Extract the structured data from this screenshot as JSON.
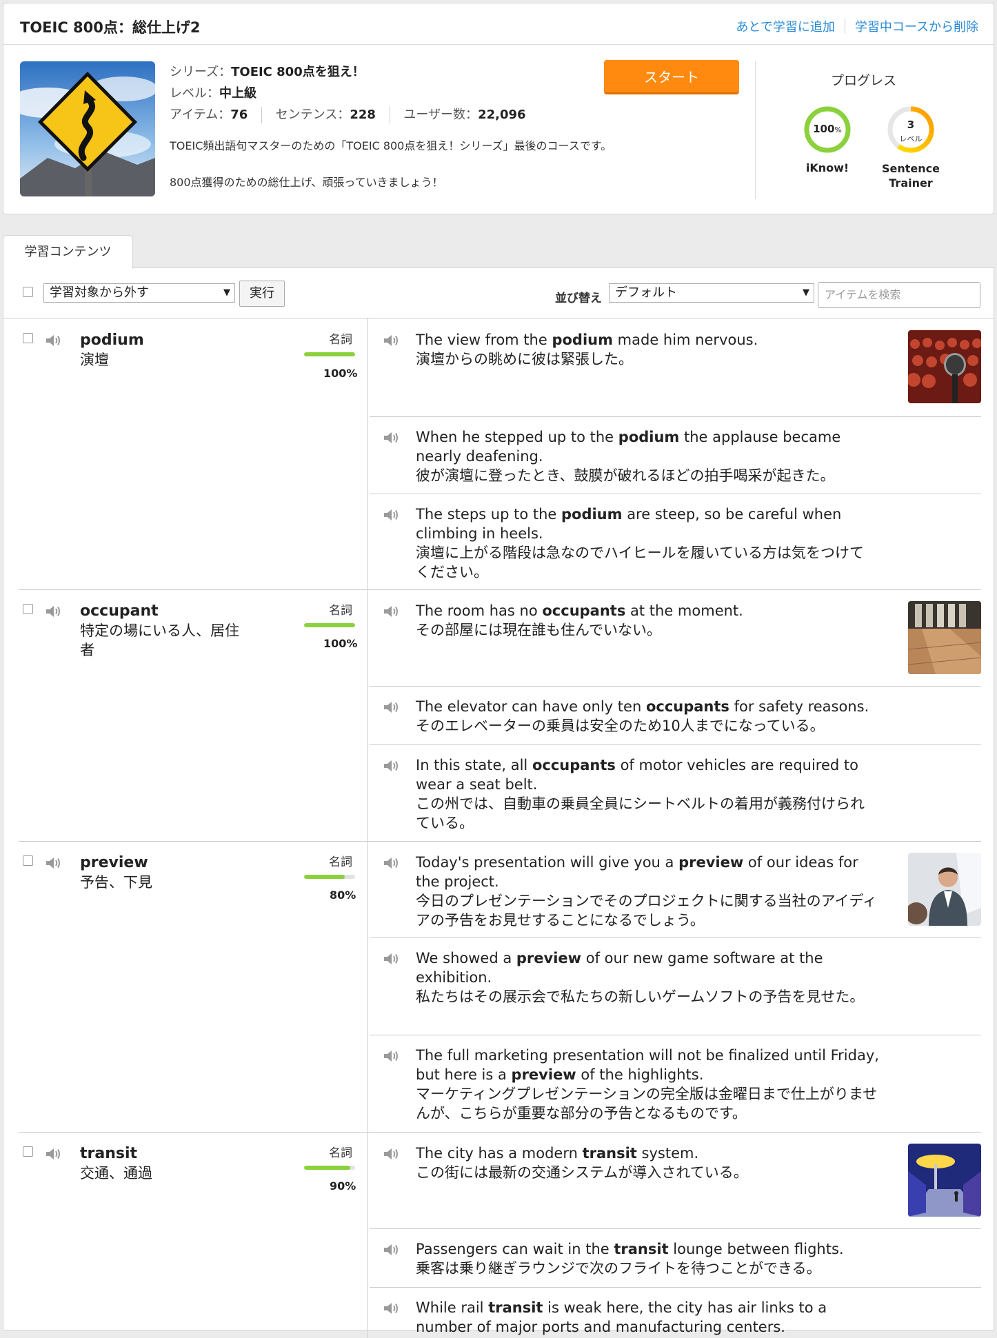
{
  "course": {
    "title": "TOEIC 800点：総仕上げ2",
    "link_add_later": "あとで学習に追加",
    "link_remove": "学習中コースから削除",
    "series_label": "シリーズ：",
    "series_value": "TOEIC 800点を狙え！",
    "level_label": "レベル：",
    "level_value": "中上級",
    "items_label": "アイテム：",
    "items_value": "76",
    "sentences_label": "センテンス：",
    "sentences_value": "228",
    "users_label": "ユーザー数：",
    "users_value": "22,096",
    "description_1": "TOEIC頻出語句マスターのための「TOEIC 800点を狙え！シリーズ」最後のコースです。",
    "description_2": "800点獲得のための総仕上げ、頑張っていきましょう！",
    "start_label": "スタート"
  },
  "progress": {
    "title": "プログレス",
    "iknow_value": "100",
    "iknow_unit": "%",
    "iknow_label": "iKnow!",
    "iknow_fraction": 1.0,
    "trainer_value": "3",
    "trainer_unit": "レベル",
    "trainer_label_1": "Sentence",
    "trainer_label_2": "Trainer",
    "trainer_fraction": 0.6,
    "colors": {
      "iknow": "#8bd13c",
      "trainer_start": "#ffd800",
      "trainer_end": "#ff9a00"
    }
  },
  "tab": {
    "label": "学習コンテンツ"
  },
  "toolbar": {
    "action_select": "学習対象から外す",
    "exec_label": "実行",
    "sort_label": "並び替え",
    "sort_select": "デフォルト",
    "search_placeholder": "アイテムを検索"
  },
  "items": [
    {
      "word": "podium",
      "meaning_1": "演壇",
      "meaning_2": "",
      "pos": "名詞",
      "progress": 1.0,
      "pct": "100%",
      "sentences": [
        {
          "pre": "The view from the ",
          "key": "podium",
          "post": " made him nervous.",
          "ja": "演壇からの眺めに彼は緊張した。"
        },
        {
          "pre": "When he stepped up to the ",
          "key": "podium",
          "post": " the applause became nearly deafening.",
          "ja": "彼が演壇に登ったとき、鼓膜が破れるほどの拍手喝采が起きた。"
        },
        {
          "pre": "The steps up to the ",
          "key": "podium",
          "post": " are steep, so be careful when climbing in heels.",
          "ja": "演壇に上がる階段は急なのでハイヒールを履いている方は気をつけてください。"
        }
      ]
    },
    {
      "word": "occupant",
      "meaning_1": "特定の場にいる人、居住",
      "meaning_2": "者",
      "pos": "名詞",
      "progress": 1.0,
      "pct": "100%",
      "sentences": [
        {
          "pre": "The room has no ",
          "key": "occupants",
          "post": " at the moment.",
          "ja": "その部屋には現在誰も住んでいない。"
        },
        {
          "pre": "The elevator can have only ten ",
          "key": "occupants",
          "post": " for safety reasons.",
          "ja": "そのエレベーターの乗員は安全のため10人までになっている。"
        },
        {
          "pre": "In this state, all ",
          "key": "occupants",
          "post": " of motor vehicles are required to wear a seat belt.",
          "ja": "この州では、自動車の乗員全員にシートベルトの着用が義務付けられている。"
        }
      ]
    },
    {
      "word": "preview",
      "meaning_1": "予告、下見",
      "meaning_2": "",
      "pos": "名詞",
      "progress": 0.8,
      "pct": "80%",
      "sentences": [
        {
          "pre": "Today's presentation will give you a ",
          "key": "preview",
          "post": " of our ideas for the project.",
          "ja": "今日のプレゼンテーションでそのプロジェクトに関する当社のアイディアの予告をお見せすることになるでしょう。"
        },
        {
          "pre": "We showed a ",
          "key": "preview",
          "post": " of our new game software at the exhibition.",
          "ja": "私たちはその展示会で私たちの新しいゲームソフトの予告を見せた。"
        },
        {
          "pre": "The full marketing presentation will not be finalized until Friday, but here is a ",
          "key": "preview",
          "post": " of the highlights.",
          "ja": "マーケティングプレゼンテーションの完全版は金曜日まで仕上がりませんが、こちらが重要な部分の予告となるものです。"
        }
      ]
    },
    {
      "word": "transit",
      "meaning_1": "交通、通過",
      "meaning_2": "",
      "pos": "名詞",
      "progress": 0.9,
      "pct": "90%",
      "sentences": [
        {
          "pre": "The city has a modern ",
          "key": "transit",
          "post": " system.",
          "ja": "この街には最新の交通システムが導入されている。"
        },
        {
          "pre": "Passengers can wait in the ",
          "key": "transit",
          "post": " lounge between flights.",
          "ja": "乗客は乗り継ぎラウンジで次のフライトを待つことができる。"
        },
        {
          "pre": "While rail ",
          "key": "transit",
          "post": " is weak here, the city has air links to a number of major ports and manufacturing centers.",
          "ja": ""
        }
      ]
    }
  ]
}
